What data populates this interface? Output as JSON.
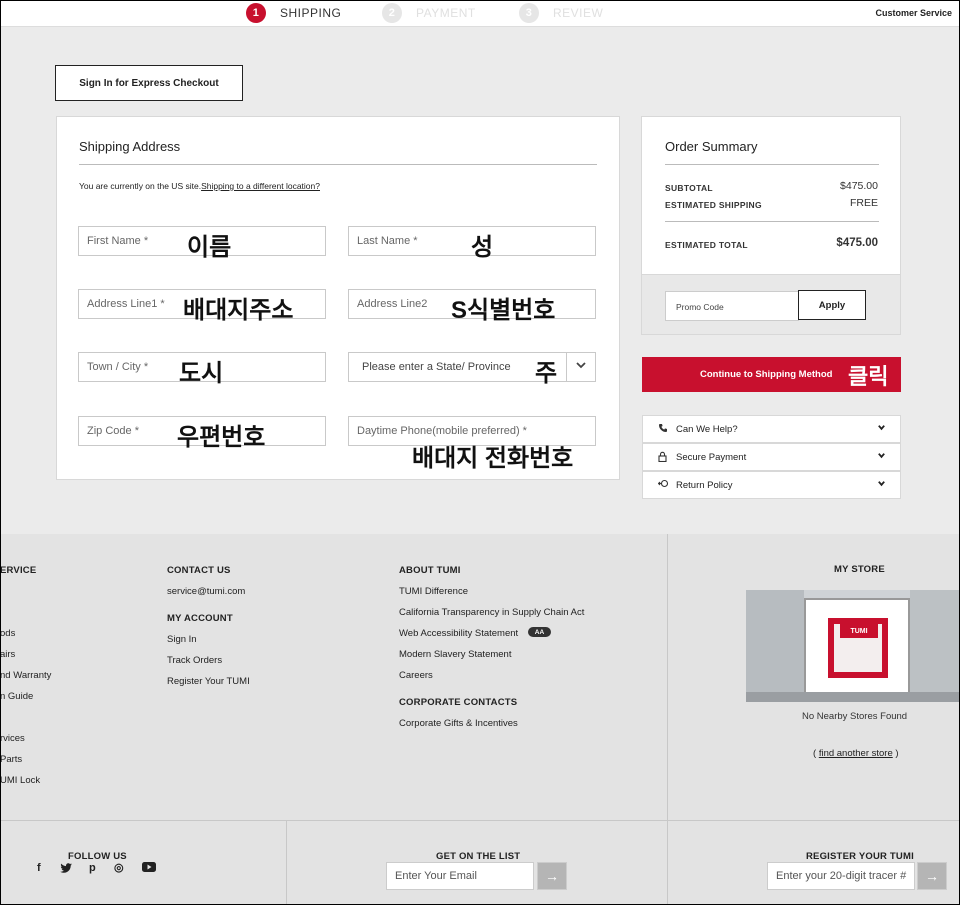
{
  "steps": [
    {
      "num": "1",
      "label": "SHIPPING"
    },
    {
      "num": "2",
      "label": "PAYMENT"
    },
    {
      "num": "3",
      "label": "REVIEW"
    }
  ],
  "header": {
    "customer_service": "Customer Service"
  },
  "express_checkout": "Sign In for Express Checkout",
  "shipping": {
    "title": "Shipping Address",
    "note": "You are currently on the US site.",
    "note_link": "Shipping to a different location?",
    "fields": {
      "first_name": {
        "placeholder": "First Name *",
        "annotation": "이름"
      },
      "last_name": {
        "placeholder": "Last Name *",
        "annotation": "성"
      },
      "address1": {
        "placeholder": "Address Line1 *",
        "annotation": "배대지주소"
      },
      "address2": {
        "placeholder": "Address Line2",
        "annotation": "S식별번호"
      },
      "city": {
        "placeholder": "Town / City *",
        "annotation": "도시"
      },
      "state": {
        "placeholder": "Please enter a State/ Province",
        "annotation": "주"
      },
      "zip": {
        "placeholder": "Zip Code *",
        "annotation": "우편번호"
      },
      "phone": {
        "placeholder": "Daytime Phone(mobile preferred) *",
        "annotation": "배대지 전화번호"
      }
    }
  },
  "order_summary": {
    "title": "Order Summary",
    "subtotal_label": "SUBTOTAL",
    "subtotal_value": "$475.00",
    "shipping_label": "ESTIMATED SHIPPING",
    "shipping_value": "FREE",
    "total_label": "ESTIMATED TOTAL",
    "total_value": "$475.00",
    "promo_placeholder": "Promo Code",
    "apply_label": "Apply"
  },
  "continue": {
    "label": "Continue to Shipping Method",
    "annotation": "클릭"
  },
  "help": [
    {
      "icon": "phone-icon",
      "label": "Can We Help?"
    },
    {
      "icon": "lock-icon",
      "label": "Secure Payment"
    },
    {
      "icon": "return-icon",
      "label": "Return Policy"
    }
  ],
  "footer": {
    "service_head": "ERVICE",
    "service_links": [
      "ods",
      "airs",
      "nd Warranty",
      "n Guide",
      "rvices",
      "Parts",
      "UMI Lock"
    ],
    "contact_head": "CONTACT US",
    "contact_email": "service@tumi.com",
    "account_head": "MY ACCOUNT",
    "account_links": [
      "Sign In",
      "Track Orders",
      "Register Your TUMI"
    ],
    "about_head": "ABOUT TUMI",
    "about_links": [
      "TUMI Difference",
      "California Transparency in Supply Chain Act",
      "Web Accessibility Statement",
      "Modern Slavery Statement",
      "Careers"
    ],
    "accessibility_badge": "AA",
    "corporate_head": "CORPORATE CONTACTS",
    "corporate_links": [
      "Corporate Gifts & Incentives"
    ],
    "store_head": "MY STORE",
    "store_sign": "TUMI",
    "store_none": "No Nearby Stores Found",
    "store_find_open": "( ",
    "store_find_link": "find another store",
    "store_find_close": " )",
    "follow_head": "FOLLOW US",
    "social": [
      "f",
      "t",
      "p",
      "◎",
      "▶"
    ],
    "list_head": "GET ON THE LIST",
    "email_placeholder": "Enter Your Email",
    "register_head": "REGISTER YOUR TUMI",
    "tracer_placeholder": "Enter your 20-digit tracer #",
    "go_arrow": "→"
  }
}
